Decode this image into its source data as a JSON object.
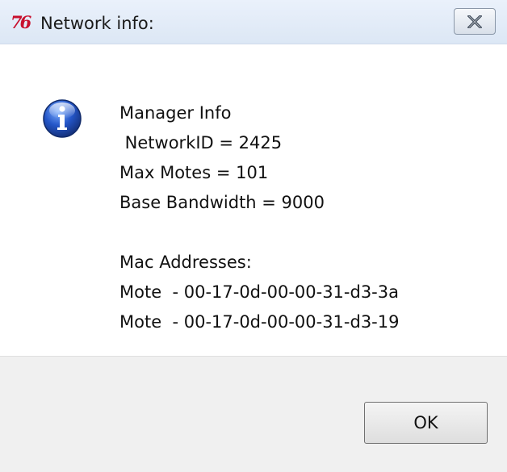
{
  "window": {
    "title": "Network info:",
    "app_icon_label": "76"
  },
  "message": {
    "icon": "info-icon",
    "lines": [
      "Manager Info",
      " NetworkID = 2425",
      "Max Motes = 101",
      "Base Bandwidth = 9000",
      "",
      "Mac Addresses:",
      "Mote  - 00-17-0d-00-00-31-d3-3a",
      "Mote  - 00-17-0d-00-00-31-d3-19"
    ]
  },
  "buttons": {
    "ok_label": "OK",
    "close_icon": "close-icon"
  },
  "colors": {
    "titlebar": "#dce7f5",
    "footer": "#f0f0f0",
    "brand": "#c8102e",
    "info_blue": "#1f4fb8"
  }
}
